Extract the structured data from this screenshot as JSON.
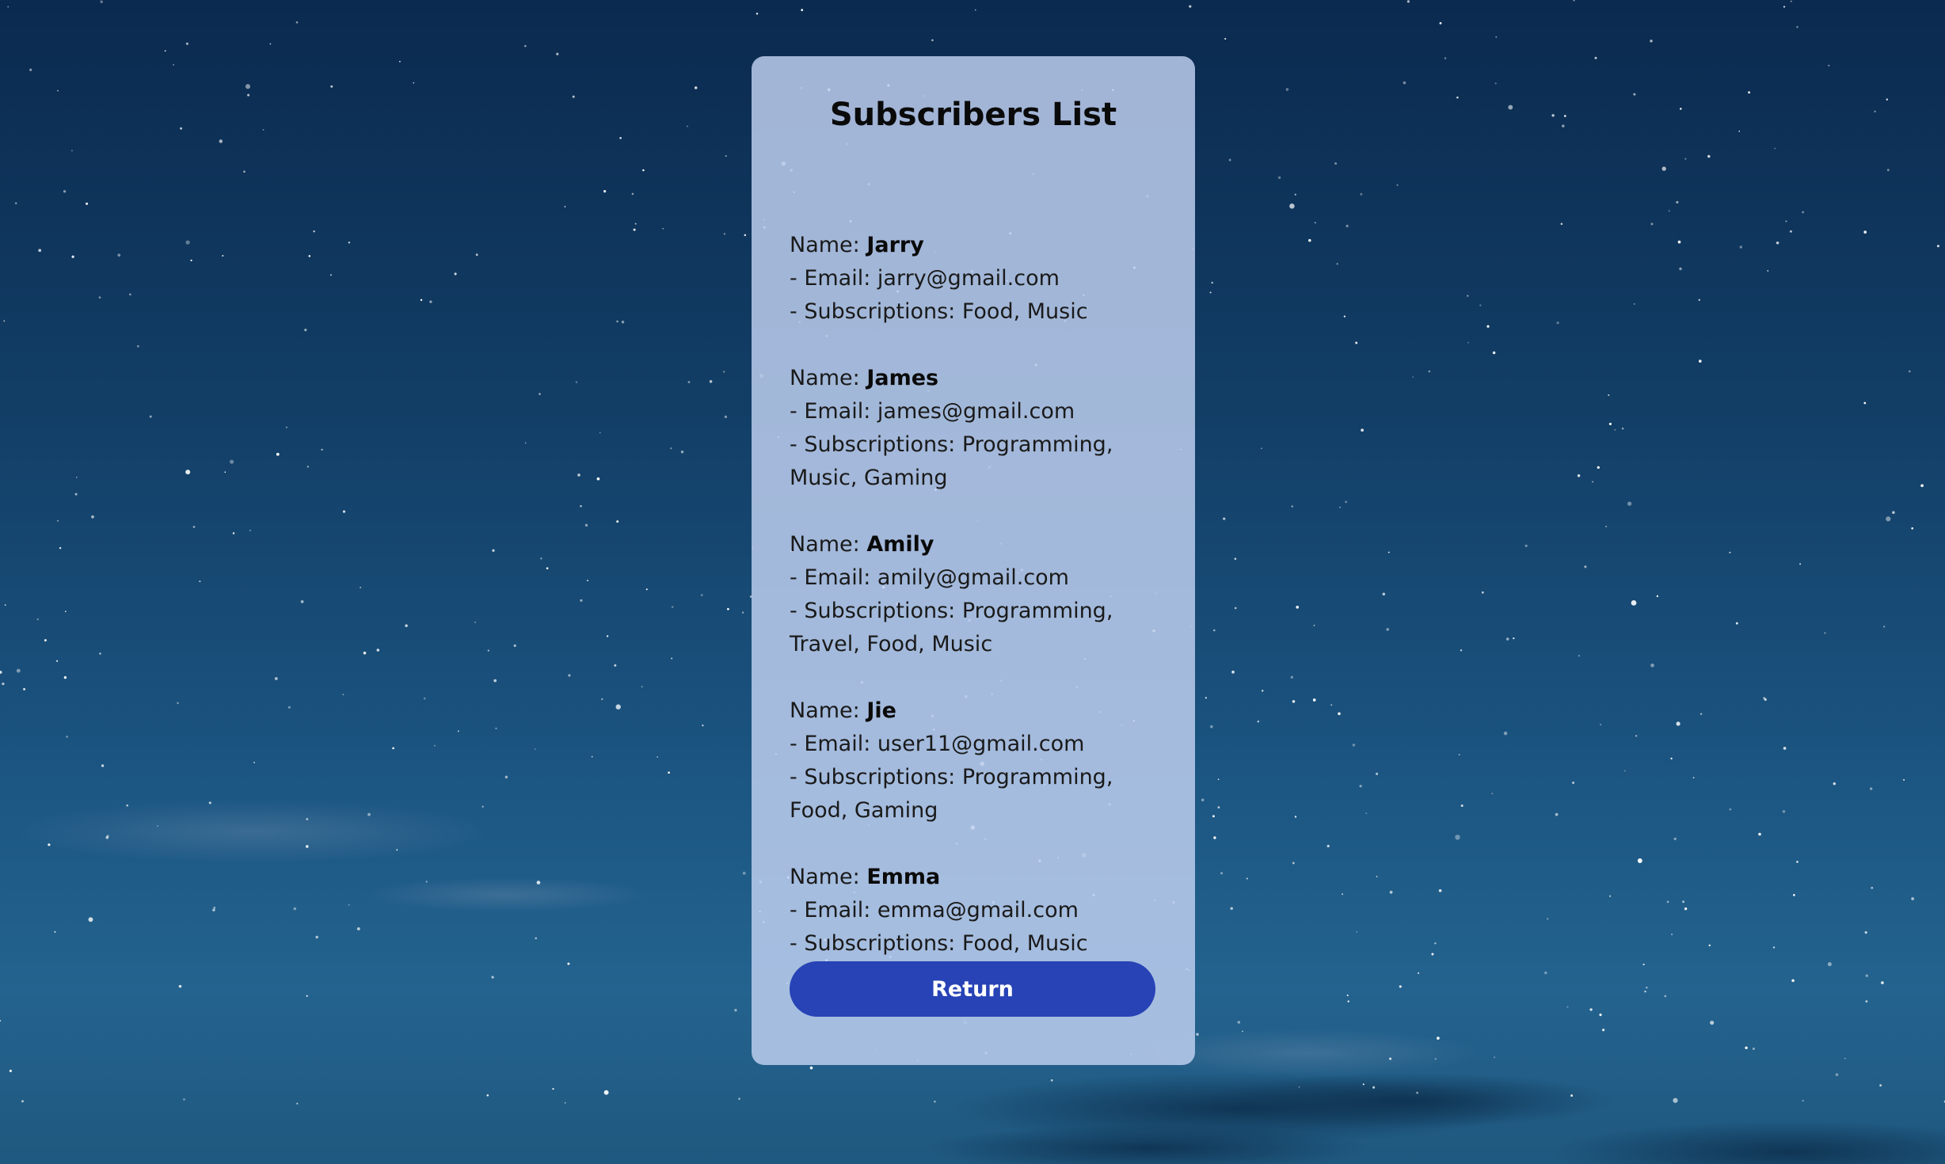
{
  "page": {
    "title": "Subscribers List",
    "name_prefix": "Name: ",
    "email_prefix": "- Email: ",
    "subscriptions_prefix": "- Subscriptions: "
  },
  "subscribers": [
    {
      "name": "Jarry",
      "email": "jarry@gmail.com",
      "subscriptions": "Food, Music"
    },
    {
      "name": "James",
      "email": "james@gmail.com",
      "subscriptions": "Programming, Music, Gaming"
    },
    {
      "name": "Amily",
      "email": "amily@gmail.com",
      "subscriptions": "Programming, Travel, Food, Music"
    },
    {
      "name": "Jie",
      "email": "user11@gmail.com",
      "subscriptions": "Programming, Food, Gaming"
    },
    {
      "name": "Emma",
      "email": "emma@gmail.com",
      "subscriptions": "Food, Music"
    }
  ],
  "return_button": {
    "label": "Return"
  },
  "colors": {
    "card_background": "#bfcfef",
    "button": "#2743b6",
    "sky_top": "#0b2a4f",
    "sky_bottom": "#24638f"
  }
}
